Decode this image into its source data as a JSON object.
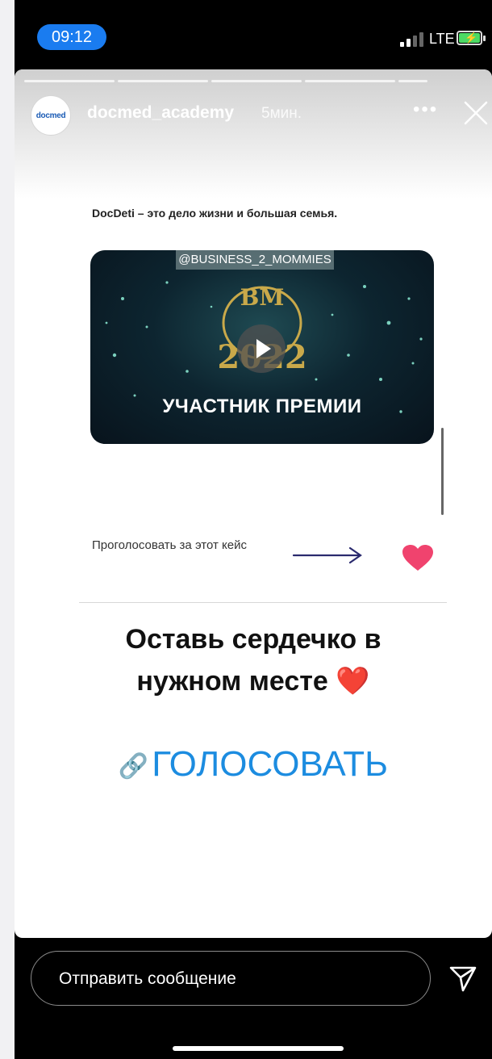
{
  "status_bar": {
    "time": "09:12",
    "network": "LTE"
  },
  "story": {
    "username": "docmed_academy",
    "time_ago": "5мин.",
    "avatar_text": "docmed",
    "more_label": "•••",
    "progress_segments": 5
  },
  "content": {
    "intro": "DocDeti – это дело жизни и большая семья.",
    "video_tag": "@BUSINESS_2_MOMMIES",
    "video_caption": "УЧАСТНИК ПРЕМИИ",
    "vote_text": "Проголосовать за этот кейс",
    "cta_line1": "Оставь сердечко в",
    "cta_line2": "нужном месте ❤️",
    "link_label": "ГОЛОСОВАТЬ",
    "link_icon": "🔗"
  },
  "footer": {
    "message_placeholder": "Отправить сообщение"
  },
  "colors": {
    "accent": "#1a7cf0",
    "link": "#1c8ce0",
    "heart": "#f0436e",
    "arrow": "#2a2a6e"
  },
  "icons": [
    "signal-icon",
    "battery-icon",
    "close-icon",
    "play-icon",
    "arrow-right-icon",
    "heart-icon",
    "link-icon",
    "send-icon"
  ]
}
